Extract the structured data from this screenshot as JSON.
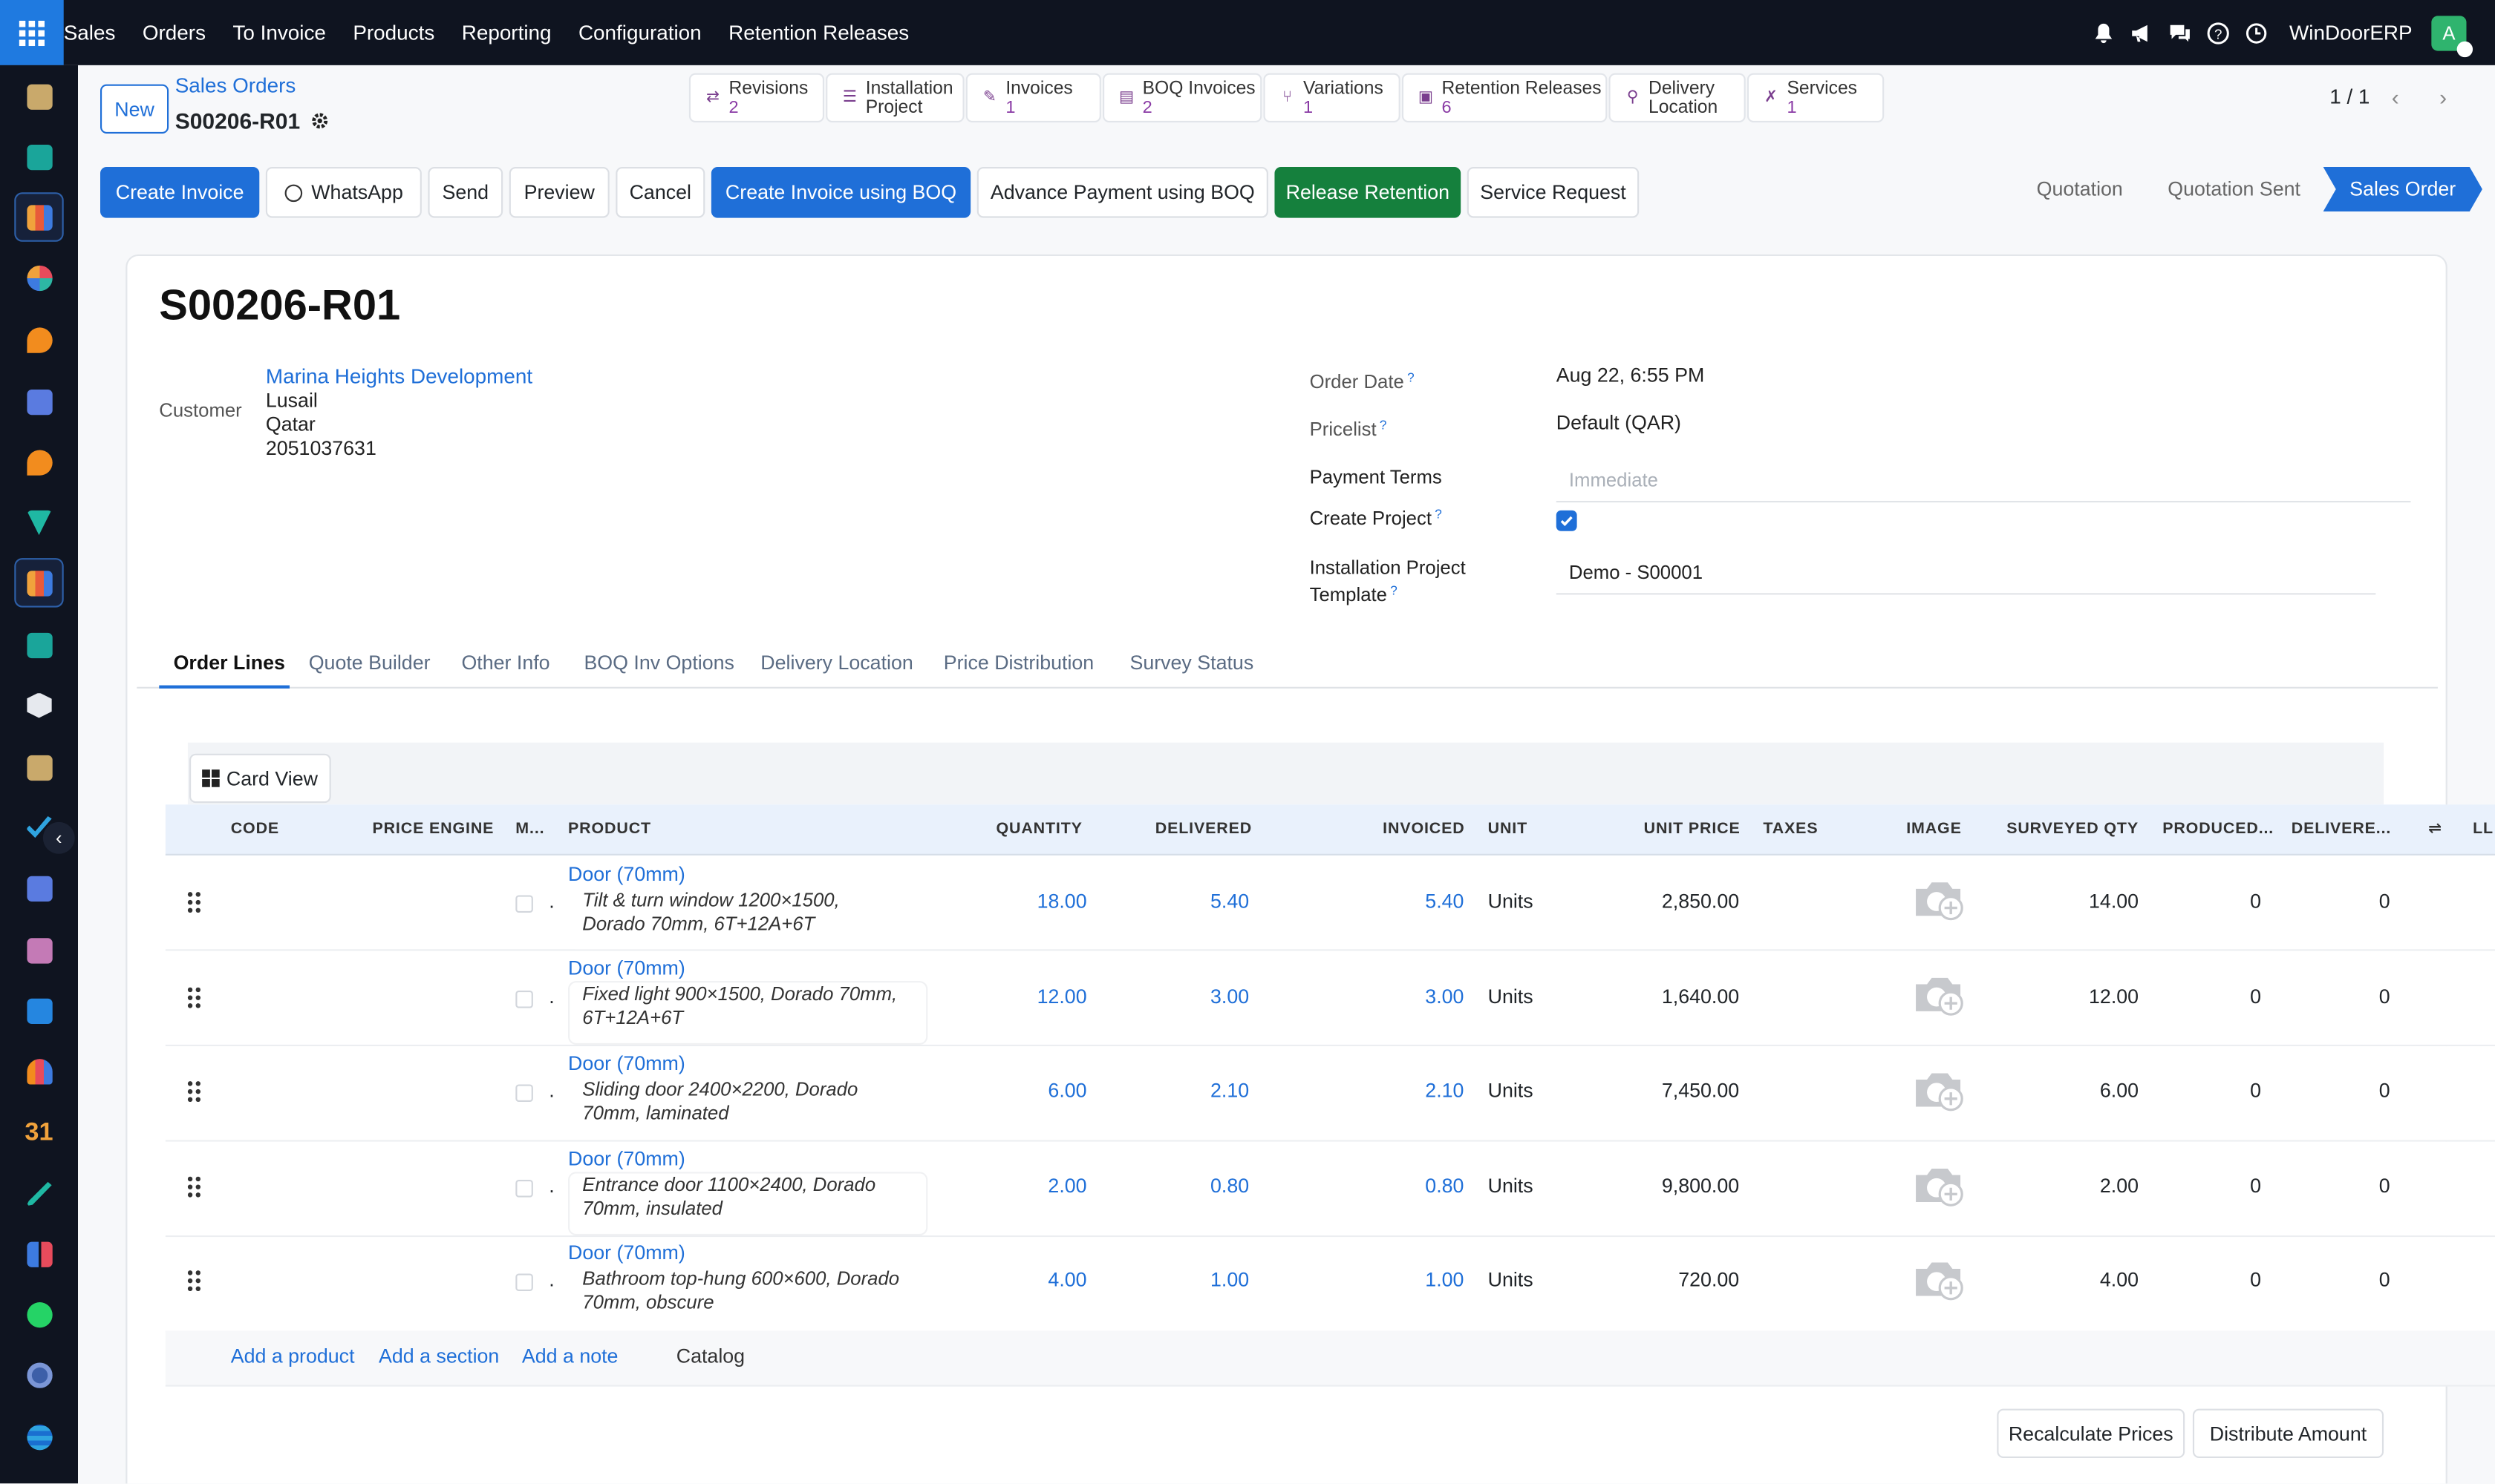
{
  "topbar": {
    "menu": [
      "Sales",
      "Orders",
      "To Invoice",
      "Products",
      "Reporting",
      "Configuration",
      "Retention Releases"
    ],
    "company": "WinDoorERP",
    "avatar_letter": "A",
    "brand_color": "#1f6fd8"
  },
  "control": {
    "new_label": "New",
    "breadcrumb_parent": "Sales Orders",
    "record_name": "S00206-R01",
    "pager": "1 / 1"
  },
  "smart_buttons": [
    {
      "label": "Revisions",
      "value": "2",
      "icon": "revisions-icon"
    },
    {
      "label": "Installation",
      "label2": "Project",
      "value": "",
      "icon": "project-icon"
    },
    {
      "label": "Invoices",
      "value": "1",
      "icon": "invoice-icon"
    },
    {
      "label": "BOQ Invoices",
      "value": "2",
      "icon": "boq-invoice-icon"
    },
    {
      "label": "Variations",
      "value": "1",
      "icon": "variations-icon"
    },
    {
      "label": "Retention Releases",
      "value": "6",
      "icon": "retention-icon"
    },
    {
      "label": "Delivery",
      "label2": "Location",
      "value": "",
      "icon": "location-icon"
    },
    {
      "label": "Services",
      "value": "1",
      "icon": "wrench-icon"
    }
  ],
  "actions": {
    "create_invoice": "Create Invoice",
    "whatsapp": "WhatsApp",
    "send": "Send",
    "preview": "Preview",
    "cancel": "Cancel",
    "create_invoice_boq": "Create Invoice using BOQ",
    "advance_payment_boq": "Advance Payment using BOQ",
    "release_retention": "Release Retention",
    "service_request": "Service Request"
  },
  "statusbar": [
    "Quotation",
    "Quotation Sent",
    "Sales Order"
  ],
  "form": {
    "title": "S00206-R01",
    "customer_label": "Customer",
    "customer_name": "Marina Heights Development",
    "customer_city": "Lusail",
    "customer_country": "Qatar",
    "customer_phone": "2051037631",
    "order_date_label": "Order Date",
    "order_date": "Aug 22, 6:55 PM",
    "pricelist_label": "Pricelist",
    "pricelist": "Default (QAR)",
    "payment_terms_label": "Payment Terms",
    "payment_terms_placeholder": "Immediate",
    "create_project_label": "Create Project",
    "install_template_label1": "Installation Project",
    "install_template_label2": "Template",
    "install_template": "Demo - S00001",
    "help_mark": "?"
  },
  "tabs": [
    "Order Lines",
    "Quote Builder",
    "Other Info",
    "BOQ Inv Options",
    "Delivery Location",
    "Price Distribution",
    "Survey Status"
  ],
  "card_view_label": "Card View",
  "columns": {
    "code": "CODE",
    "price_engine": "PRICE ENGINE",
    "m": "M...",
    "product": "PRODUCT",
    "quantity": "QUANTITY",
    "delivered": "DELIVERED",
    "invoiced": "INVOICED",
    "unit": "UNIT",
    "unit_price": "UNIT PRICE",
    "taxes": "TAXES",
    "image": "IMAGE",
    "surveyed_qty": "SURVEYED QTY",
    "produced": "PRODUCED...",
    "delivered2": "DELIVERE...",
    "ll": "LL"
  },
  "lines": [
    {
      "product": "Door (70mm)",
      "desc1": "Tilt & turn window 1200×1500,",
      "desc2": "Dorado 70mm, 6T+12A+6T",
      "qty": "18.00",
      "delivered": "5.40",
      "invoiced": "5.40",
      "unit": "Units",
      "price": "2,850.00",
      "surveyed": "14.00",
      "produced": "0",
      "delivered2": "0",
      "dot": "."
    },
    {
      "product": "Door (70mm)",
      "desc1": "Fixed light 900×1500, Dorado 70mm,",
      "desc2": "6T+12A+6T",
      "qty": "12.00",
      "delivered": "3.00",
      "invoiced": "3.00",
      "unit": "Units",
      "price": "1,640.00",
      "surveyed": "12.00",
      "produced": "0",
      "delivered2": "0",
      "dot": "."
    },
    {
      "product": "Door (70mm)",
      "desc1": "Sliding door 2400×2200, Dorado",
      "desc2": "70mm, laminated",
      "qty": "6.00",
      "delivered": "2.10",
      "invoiced": "2.10",
      "unit": "Units",
      "price": "7,450.00",
      "surveyed": "6.00",
      "produced": "0",
      "delivered2": "0",
      "dot": "."
    },
    {
      "product": "Door (70mm)",
      "desc1": "Entrance door 1100×2400, Dorado",
      "desc2": "70mm, insulated",
      "qty": "2.00",
      "delivered": "0.80",
      "invoiced": "0.80",
      "unit": "Units",
      "price": "9,800.00",
      "surveyed": "2.00",
      "produced": "0",
      "delivered2": "0",
      "dot": "."
    },
    {
      "product": "Door (70mm)",
      "desc1": "Bathroom top-hung 600×600, Dorado",
      "desc2": "70mm, obscure",
      "qty": "4.00",
      "delivered": "1.00",
      "invoiced": "1.00",
      "unit": "Units",
      "price": "720.00",
      "surveyed": "4.00",
      "produced": "0",
      "delivered2": "0",
      "dot": "."
    }
  ],
  "add_links": {
    "product": "Add a product",
    "section": "Add a section",
    "note": "Add a note",
    "catalog": "Catalog"
  },
  "bottom": {
    "recalculate": "Recalculate Prices",
    "distribute": "Distribute Amount"
  }
}
